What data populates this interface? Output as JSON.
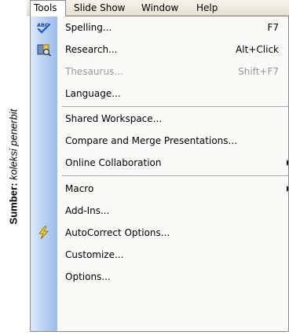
{
  "caption": {
    "label": "Sumber:",
    "source": "koleksi penerbit"
  },
  "menubar": {
    "tools": "Tools",
    "slide_show": "Slide Show",
    "window": "Window",
    "help": "Help"
  },
  "menu": {
    "spelling": {
      "label": "Spelling...",
      "shortcut": "F7"
    },
    "research": {
      "label": "Research...",
      "shortcut": "Alt+Click"
    },
    "thesaurus": {
      "label": "Thesaurus...",
      "shortcut": "Shift+F7"
    },
    "language": {
      "label": "Language..."
    },
    "shared_workspace": {
      "label": "Shared Workspace..."
    },
    "compare_merge": {
      "label": "Compare and Merge Presentations..."
    },
    "online_collaboration": {
      "label": "Online Collaboration"
    },
    "macro": {
      "label": "Macro"
    },
    "add_ins": {
      "label": "Add-Ins..."
    },
    "autocorrect": {
      "label": "AutoCorrect Options..."
    },
    "customize": {
      "label": "Customize..."
    },
    "options": {
      "label": "Options..."
    }
  },
  "colors": {
    "gutter_light": "#dce9fb",
    "gutter_dark": "#9bbbe9",
    "menu_bg": "#fbfaf6",
    "disabled_text": "#9a9a9a"
  },
  "icons": {
    "spelling": "spelling-abc-check-icon",
    "research": "research-book-icon",
    "autocorrect": "autocorrect-lightning-icon"
  }
}
